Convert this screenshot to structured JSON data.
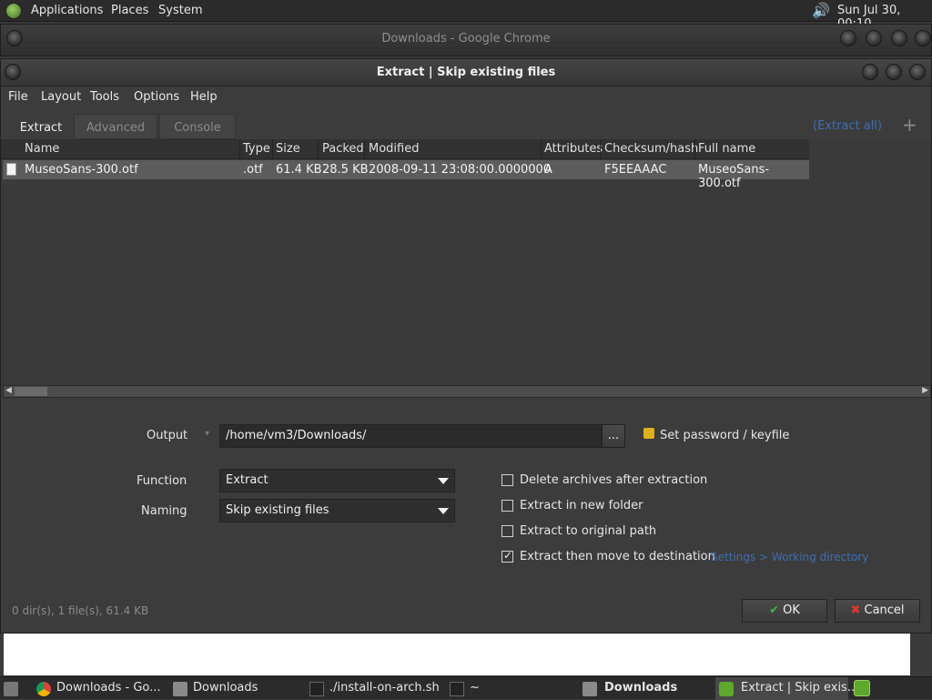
{
  "top_panel": {
    "menus": [
      "Applications",
      "Places",
      "System"
    ],
    "clock": "Sun Jul 30, 00:10"
  },
  "chrome_window": {
    "title": "Downloads - Google Chrome"
  },
  "dialog": {
    "title": "Extract | Skip existing files",
    "menus": [
      "File",
      "Layout",
      "Tools",
      "Options",
      "Help"
    ],
    "tabs": [
      "Extract",
      "Advanced",
      "Console"
    ],
    "extract_all": "(Extract all)",
    "add": "+",
    "columns": [
      "Name",
      "Type",
      "Size",
      "Packed",
      "Modified",
      "Attributes",
      "Checksum/hash",
      "Full name"
    ],
    "rows": [
      [
        "MuseoSans-300.otf",
        ".otf",
        "61.4 KB",
        "28.5 KB",
        "2008-09-11 23:08:00.0000000",
        "A",
        "F5EEAAAC",
        "MuseoSans-300.otf"
      ]
    ],
    "output_label": "Output",
    "output_value": "/home/vm3/Downloads/",
    "browse": "...",
    "password": "Set password / keyfile",
    "function_label": "Function",
    "function_value": "Extract",
    "naming_label": "Naming",
    "naming_value": "Skip existing files",
    "options": [
      {
        "label": "Delete archives after extraction",
        "checked": false
      },
      {
        "label": "Extract in new folder",
        "checked": false
      },
      {
        "label": "Extract to original path",
        "checked": false
      },
      {
        "label": "Extract then move to destination",
        "checked": true
      }
    ],
    "settings_link": "Settings > Working directory",
    "status": "0 dir(s), 1 file(s), 61.4 KB",
    "ok": "OK",
    "cancel": "Cancel"
  },
  "taskbar": {
    "items": [
      "Downloads - Go...",
      "Downloads",
      "./install-on-arch.sh",
      "~",
      "Downloads",
      "Extract | Skip exis..."
    ]
  }
}
